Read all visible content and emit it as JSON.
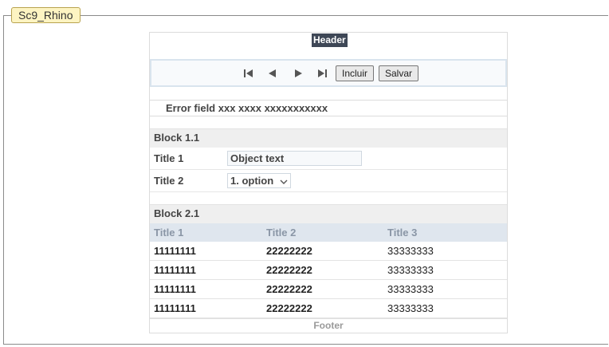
{
  "frame": {
    "title": "Sc9_Rhino"
  },
  "header": {
    "label": "Header"
  },
  "toolbar": {
    "nav_icons": [
      "first-page-icon",
      "previous-page-icon",
      "next-page-icon",
      "last-page-icon"
    ],
    "include_label": "Incluir",
    "save_label": "Salvar"
  },
  "error": {
    "text": "Error field xxx xxxx xxxxxxxxxxx"
  },
  "block1": {
    "title": "Block 1.1",
    "field1": {
      "label": "Title 1",
      "value": "Object text"
    },
    "field2": {
      "label": "Title 2",
      "selected": "1. option"
    }
  },
  "block2": {
    "title": "Block 2.1",
    "columns": [
      "Title 1",
      "Title 2",
      "Title 3"
    ],
    "rows": [
      [
        "11111111",
        "22222222",
        "33333333"
      ],
      [
        "11111111",
        "22222222",
        "33333333"
      ],
      [
        "11111111",
        "22222222",
        "33333333"
      ],
      [
        "11111111",
        "22222222",
        "33333333"
      ]
    ]
  },
  "footer": {
    "label": "Footer"
  },
  "colors": {
    "tab_bg": "#fdf4c2",
    "header_bg": "#3e4756",
    "grid_header_bg": "#dfe6ee",
    "block_title_bg": "#efefef"
  }
}
